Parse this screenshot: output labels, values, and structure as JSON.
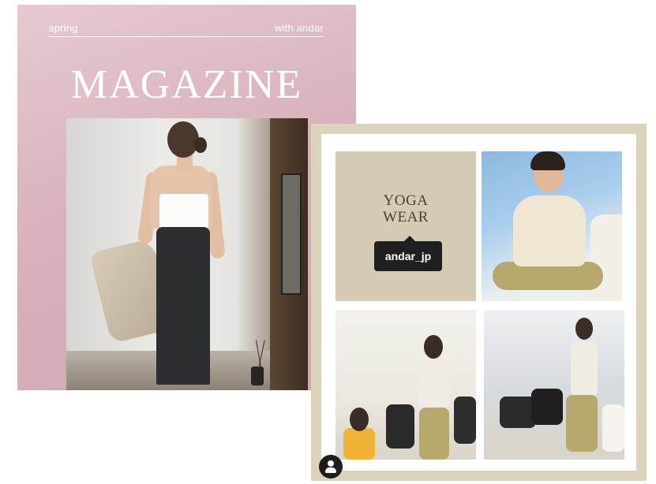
{
  "magazine": {
    "top_left": "spring",
    "top_right": "with andar",
    "title": "MAGAZINE"
  },
  "yoga_post": {
    "title_line1": "YOGA",
    "title_line2": "WEAR",
    "tag": "andar_jp"
  },
  "icons": {
    "profile": "user-profile-icon"
  },
  "colors": {
    "magazine_bg": "#d8b3bb",
    "yoga_frame": "#ddd3bd",
    "yoga_tile": "#d5cab4",
    "tag_bg": "#1f1f1f"
  }
}
